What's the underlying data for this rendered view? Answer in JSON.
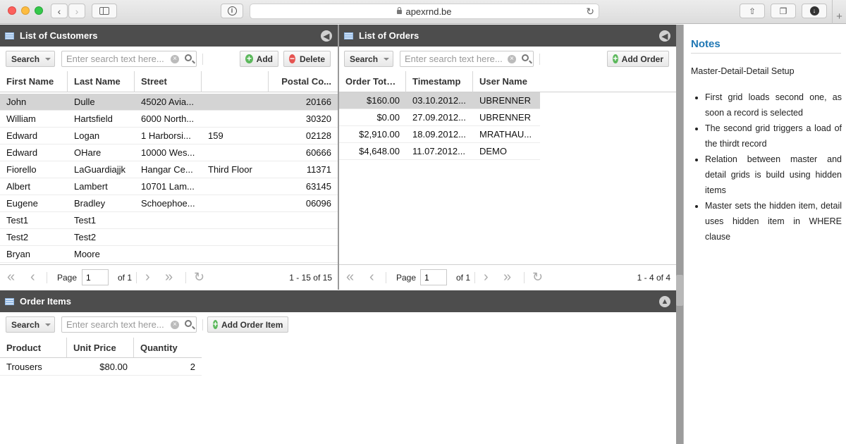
{
  "browser": {
    "url": "apexrnd.be"
  },
  "customers": {
    "title": "List of Customers",
    "search_label": "Search",
    "search_placeholder": "Enter search text here...",
    "add_label": "Add",
    "delete_label": "Delete",
    "columns": [
      "First Name",
      "Last Name",
      "Street",
      "",
      "Postal Co..."
    ],
    "rows": [
      {
        "first": "John",
        "last": "Dulle",
        "street": "45020 Avia...",
        "street2": "",
        "postal": "20166"
      },
      {
        "first": "William",
        "last": "Hartsfield",
        "street": "6000 North...",
        "street2": "",
        "postal": "30320"
      },
      {
        "first": "Edward",
        "last": "Logan",
        "street": "1 Harborsi...",
        "street2": "159",
        "postal": "02128"
      },
      {
        "first": "Edward",
        "last": "OHare",
        "street": "10000 Wes...",
        "street2": "",
        "postal": "60666"
      },
      {
        "first": "Fiorello",
        "last": "LaGuardiajjk",
        "street": "Hangar Ce...",
        "street2": "Third Floor",
        "postal": "11371"
      },
      {
        "first": "Albert",
        "last": "Lambert",
        "street": "10701 Lam...",
        "street2": "",
        "postal": "63145"
      },
      {
        "first": "Eugene",
        "last": "Bradley",
        "street": "Schoephoe...",
        "street2": "",
        "postal": "06096"
      },
      {
        "first": "Test1",
        "last": "Test1",
        "street": "",
        "street2": "",
        "postal": ""
      },
      {
        "first": "Test2",
        "last": "Test2",
        "street": "",
        "street2": "",
        "postal": ""
      },
      {
        "first": "Bryan",
        "last": "Moore",
        "street": "",
        "street2": "",
        "postal": ""
      }
    ],
    "pager": {
      "page_label": "Page",
      "page_value": "1",
      "of_label": "of 1",
      "range": "1 - 15 of 15"
    }
  },
  "orders": {
    "title": "List of Orders",
    "search_label": "Search",
    "search_placeholder": "Enter search text here...",
    "add_label": "Add Order",
    "columns": [
      "Order Tota...",
      "Timestamp",
      "User Name"
    ],
    "rows": [
      {
        "total": "$160.00",
        "timestamp": "03.10.2012...",
        "user": "UBRENNER"
      },
      {
        "total": "$0.00",
        "timestamp": "27.09.2012...",
        "user": "UBRENNER"
      },
      {
        "total": "$2,910.00",
        "timestamp": "18.09.2012...",
        "user": "MRATHAU..."
      },
      {
        "total": "$4,648.00",
        "timestamp": "11.07.2012...",
        "user": "DEMO"
      }
    ],
    "pager": {
      "page_label": "Page",
      "page_value": "1",
      "of_label": "of 1",
      "range": "1 - 4 of 4"
    }
  },
  "order_items": {
    "title": "Order Items",
    "search_label": "Search",
    "search_placeholder": "Enter search text here...",
    "add_label": "Add Order Item",
    "columns": [
      "Product",
      "Unit Price",
      "Quantity"
    ],
    "rows": [
      {
        "product": "Trousers",
        "price": "$80.00",
        "quantity": "2"
      }
    ]
  },
  "notes": {
    "title": "Notes",
    "subtitle": "Master-Detail-Detail Setup",
    "items": [
      "First grid loads second one, as soon a record is selected",
      "The second grid triggers a load of the thirdt record",
      "Relation between master and detail grids is build using hidden items",
      "Master sets the hidden item, detail uses hidden item in WHERE clause"
    ]
  }
}
